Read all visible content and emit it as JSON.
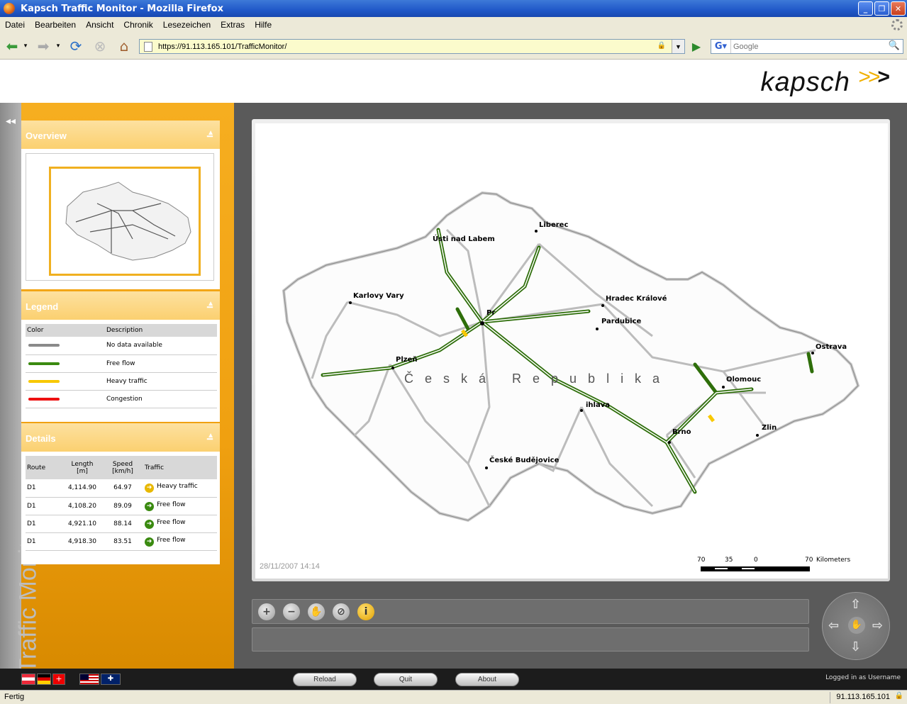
{
  "window": {
    "title": "Kapsch Traffic Monitor - Mozilla Firefox"
  },
  "menu": [
    "Datei",
    "Bearbeiten",
    "Ansicht",
    "Chronik",
    "Lesezeichen",
    "Extras",
    "Hilfe"
  ],
  "nav": {
    "url": "https://91.113.165.101/TrafficMonitor/",
    "search_placeholder": "Google"
  },
  "app": {
    "logo_text": "kapsch",
    "side_label": "Traffic Monitor"
  },
  "overview": {
    "title": "Overview"
  },
  "legend": {
    "title": "Legend",
    "col_color": "Color",
    "col_desc": "Description",
    "items": [
      {
        "color": "#8a8a8a",
        "label": "No data available"
      },
      {
        "color": "#3a8a10",
        "label": "Free flow"
      },
      {
        "color": "#f8c800",
        "label": "Heavy traffic"
      },
      {
        "color": "#ee1010",
        "label": "Congestion"
      }
    ]
  },
  "details": {
    "title": "Details",
    "headers": {
      "route": "Route",
      "length": "Length",
      "length_unit": "[m]",
      "speed": "Speed",
      "speed_unit": "[km/h]",
      "traffic": "Traffic"
    },
    "rows": [
      {
        "route": "D1",
        "length": "4,114.90",
        "speed": "64.97",
        "traffic": "Heavy traffic",
        "status": "heavy"
      },
      {
        "route": "D1",
        "length": "4,108.20",
        "speed": "89.09",
        "traffic": "Free flow",
        "status": "free"
      },
      {
        "route": "D1",
        "length": "4,921.10",
        "speed": "88.14",
        "traffic": "Free flow",
        "status": "free"
      },
      {
        "route": "D1",
        "length": "4,918.30",
        "speed": "83.51",
        "traffic": "Free flow",
        "status": "free"
      }
    ]
  },
  "map": {
    "country_label": "Česká Republika",
    "timestamp": "28/11/2007 14:14",
    "cities": [
      "Ústi nad Labem",
      "Liberec",
      "Karlovy Vary",
      "Hradec Králové",
      "Pr",
      "Pardubice",
      "Plzeň",
      "Ostrava",
      "Olomouc",
      "ihlava",
      "Zlin",
      "Brno",
      "České Budějovice"
    ],
    "scale": {
      "ticks": [
        "70",
        "35",
        "0",
        "70"
      ],
      "unit": "Kilometers"
    }
  },
  "tools": [
    "zoom-in",
    "zoom-out",
    "pan",
    "zoom-extent",
    "info"
  ],
  "buttons": {
    "reload": "Reload",
    "quit": "Quit",
    "about": "About"
  },
  "user": {
    "logged_in": "Logged in as Username"
  },
  "status": {
    "left": "Fertig",
    "right": "91.113.165.101"
  }
}
